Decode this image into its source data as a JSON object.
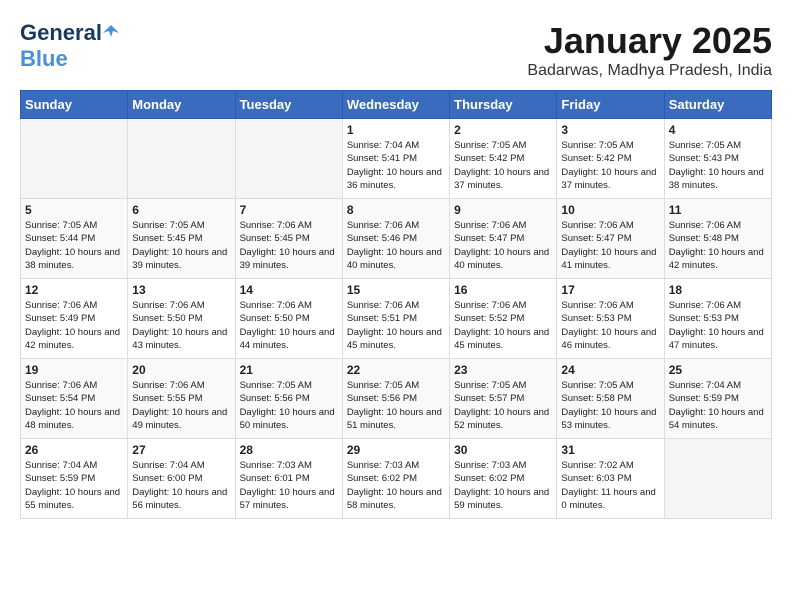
{
  "header": {
    "logo_general": "General",
    "logo_blue": "Blue",
    "month_title": "January 2025",
    "location": "Badarwas, Madhya Pradesh, India"
  },
  "days_of_week": [
    "Sunday",
    "Monday",
    "Tuesday",
    "Wednesday",
    "Thursday",
    "Friday",
    "Saturday"
  ],
  "weeks": [
    [
      {
        "day": "",
        "sunrise": "",
        "sunset": "",
        "daylight": ""
      },
      {
        "day": "",
        "sunrise": "",
        "sunset": "",
        "daylight": ""
      },
      {
        "day": "",
        "sunrise": "",
        "sunset": "",
        "daylight": ""
      },
      {
        "day": "1",
        "sunrise": "Sunrise: 7:04 AM",
        "sunset": "Sunset: 5:41 PM",
        "daylight": "Daylight: 10 hours and 36 minutes."
      },
      {
        "day": "2",
        "sunrise": "Sunrise: 7:05 AM",
        "sunset": "Sunset: 5:42 PM",
        "daylight": "Daylight: 10 hours and 37 minutes."
      },
      {
        "day": "3",
        "sunrise": "Sunrise: 7:05 AM",
        "sunset": "Sunset: 5:42 PM",
        "daylight": "Daylight: 10 hours and 37 minutes."
      },
      {
        "day": "4",
        "sunrise": "Sunrise: 7:05 AM",
        "sunset": "Sunset: 5:43 PM",
        "daylight": "Daylight: 10 hours and 38 minutes."
      }
    ],
    [
      {
        "day": "5",
        "sunrise": "Sunrise: 7:05 AM",
        "sunset": "Sunset: 5:44 PM",
        "daylight": "Daylight: 10 hours and 38 minutes."
      },
      {
        "day": "6",
        "sunrise": "Sunrise: 7:05 AM",
        "sunset": "Sunset: 5:45 PM",
        "daylight": "Daylight: 10 hours and 39 minutes."
      },
      {
        "day": "7",
        "sunrise": "Sunrise: 7:06 AM",
        "sunset": "Sunset: 5:45 PM",
        "daylight": "Daylight: 10 hours and 39 minutes."
      },
      {
        "day": "8",
        "sunrise": "Sunrise: 7:06 AM",
        "sunset": "Sunset: 5:46 PM",
        "daylight": "Daylight: 10 hours and 40 minutes."
      },
      {
        "day": "9",
        "sunrise": "Sunrise: 7:06 AM",
        "sunset": "Sunset: 5:47 PM",
        "daylight": "Daylight: 10 hours and 40 minutes."
      },
      {
        "day": "10",
        "sunrise": "Sunrise: 7:06 AM",
        "sunset": "Sunset: 5:47 PM",
        "daylight": "Daylight: 10 hours and 41 minutes."
      },
      {
        "day": "11",
        "sunrise": "Sunrise: 7:06 AM",
        "sunset": "Sunset: 5:48 PM",
        "daylight": "Daylight: 10 hours and 42 minutes."
      }
    ],
    [
      {
        "day": "12",
        "sunrise": "Sunrise: 7:06 AM",
        "sunset": "Sunset: 5:49 PM",
        "daylight": "Daylight: 10 hours and 42 minutes."
      },
      {
        "day": "13",
        "sunrise": "Sunrise: 7:06 AM",
        "sunset": "Sunset: 5:50 PM",
        "daylight": "Daylight: 10 hours and 43 minutes."
      },
      {
        "day": "14",
        "sunrise": "Sunrise: 7:06 AM",
        "sunset": "Sunset: 5:50 PM",
        "daylight": "Daylight: 10 hours and 44 minutes."
      },
      {
        "day": "15",
        "sunrise": "Sunrise: 7:06 AM",
        "sunset": "Sunset: 5:51 PM",
        "daylight": "Daylight: 10 hours and 45 minutes."
      },
      {
        "day": "16",
        "sunrise": "Sunrise: 7:06 AM",
        "sunset": "Sunset: 5:52 PM",
        "daylight": "Daylight: 10 hours and 45 minutes."
      },
      {
        "day": "17",
        "sunrise": "Sunrise: 7:06 AM",
        "sunset": "Sunset: 5:53 PM",
        "daylight": "Daylight: 10 hours and 46 minutes."
      },
      {
        "day": "18",
        "sunrise": "Sunrise: 7:06 AM",
        "sunset": "Sunset: 5:53 PM",
        "daylight": "Daylight: 10 hours and 47 minutes."
      }
    ],
    [
      {
        "day": "19",
        "sunrise": "Sunrise: 7:06 AM",
        "sunset": "Sunset: 5:54 PM",
        "daylight": "Daylight: 10 hours and 48 minutes."
      },
      {
        "day": "20",
        "sunrise": "Sunrise: 7:06 AM",
        "sunset": "Sunset: 5:55 PM",
        "daylight": "Daylight: 10 hours and 49 minutes."
      },
      {
        "day": "21",
        "sunrise": "Sunrise: 7:05 AM",
        "sunset": "Sunset: 5:56 PM",
        "daylight": "Daylight: 10 hours and 50 minutes."
      },
      {
        "day": "22",
        "sunrise": "Sunrise: 7:05 AM",
        "sunset": "Sunset: 5:56 PM",
        "daylight": "Daylight: 10 hours and 51 minutes."
      },
      {
        "day": "23",
        "sunrise": "Sunrise: 7:05 AM",
        "sunset": "Sunset: 5:57 PM",
        "daylight": "Daylight: 10 hours and 52 minutes."
      },
      {
        "day": "24",
        "sunrise": "Sunrise: 7:05 AM",
        "sunset": "Sunset: 5:58 PM",
        "daylight": "Daylight: 10 hours and 53 minutes."
      },
      {
        "day": "25",
        "sunrise": "Sunrise: 7:04 AM",
        "sunset": "Sunset: 5:59 PM",
        "daylight": "Daylight: 10 hours and 54 minutes."
      }
    ],
    [
      {
        "day": "26",
        "sunrise": "Sunrise: 7:04 AM",
        "sunset": "Sunset: 5:59 PM",
        "daylight": "Daylight: 10 hours and 55 minutes."
      },
      {
        "day": "27",
        "sunrise": "Sunrise: 7:04 AM",
        "sunset": "Sunset: 6:00 PM",
        "daylight": "Daylight: 10 hours and 56 minutes."
      },
      {
        "day": "28",
        "sunrise": "Sunrise: 7:03 AM",
        "sunset": "Sunset: 6:01 PM",
        "daylight": "Daylight: 10 hours and 57 minutes."
      },
      {
        "day": "29",
        "sunrise": "Sunrise: 7:03 AM",
        "sunset": "Sunset: 6:02 PM",
        "daylight": "Daylight: 10 hours and 58 minutes."
      },
      {
        "day": "30",
        "sunrise": "Sunrise: 7:03 AM",
        "sunset": "Sunset: 6:02 PM",
        "daylight": "Daylight: 10 hours and 59 minutes."
      },
      {
        "day": "31",
        "sunrise": "Sunrise: 7:02 AM",
        "sunset": "Sunset: 6:03 PM",
        "daylight": "Daylight: 11 hours and 0 minutes."
      },
      {
        "day": "",
        "sunrise": "",
        "sunset": "",
        "daylight": ""
      }
    ]
  ]
}
